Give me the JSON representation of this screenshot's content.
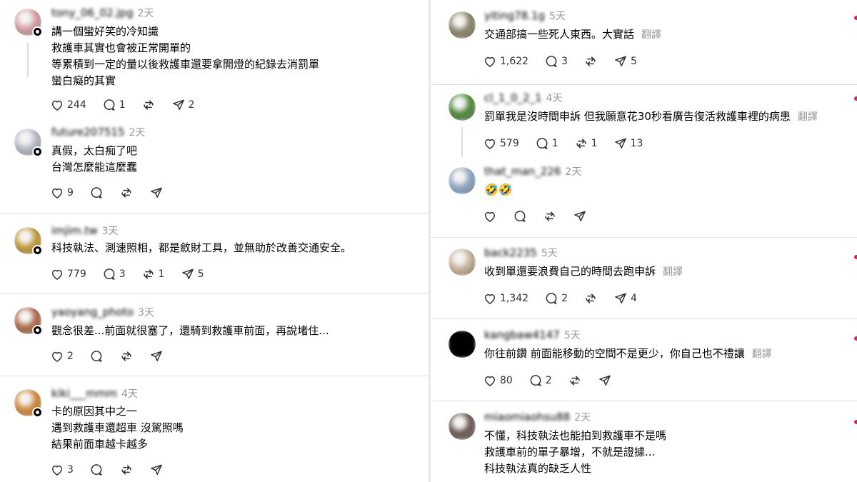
{
  "left": [
    {
      "username": "tony_06_02.jpg",
      "time": "2天",
      "lines": [
        "講一個蠻好笑的冷知識",
        "救護車其實也會被正常開單的",
        "等累積到一定的量以後救護車還要拿開燈的紀錄去消罰單",
        "蠻白癡的其實"
      ],
      "likes": "244",
      "replies": "1",
      "reposts": "",
      "shares": "2",
      "avatar_color": "#d9a0a8"
    },
    {
      "username": "future207515",
      "time": "2天",
      "lines": [
        "真假，太白痴了吧",
        "台灣怎麼能這麼蠢"
      ],
      "likes": "9",
      "replies": "",
      "reposts": "",
      "shares": "",
      "avatar_color": "#b8bcc6"
    },
    {
      "username": "imjim.tw",
      "time": "3天",
      "lines": [
        "科技執法、測速照相，都是斂財工具，並無助於改善交通安全。"
      ],
      "likes": "779",
      "replies": "3",
      "reposts": "1",
      "shares": "5",
      "avatar_color": "#c49a3a"
    },
    {
      "username": "yaoyang_photo",
      "time": "3天",
      "lines": [
        "觀念很差...前面就很塞了，還騎到救護車前面，再說堵住..."
      ],
      "likes": "2",
      "replies": "",
      "reposts": "",
      "shares": "",
      "avatar_color": "#b06a48"
    },
    {
      "username": "kiki___mmm",
      "time": "4天",
      "lines": [
        "卡的原因其中之一",
        "遇到救護車還超車 沒駕照嗎",
        "結果前面車越卡越多"
      ],
      "likes": "3",
      "replies": "",
      "reposts": "",
      "shares": "",
      "avatar_color": "#d48a3a"
    }
  ],
  "right": [
    {
      "username": "yiting78.1g",
      "time": "5天",
      "lines": [
        "交通部搞一些死人東西。大實話"
      ],
      "translate": "翻譯",
      "likes": "1,622",
      "replies": "3",
      "reposts": "",
      "shares": "5",
      "avatar_color": "#8a8466"
    },
    {
      "username": "cl_1_0_2_1",
      "time": "4天",
      "lines": [
        "罰單我是沒時間申訴 但我願意花30秒看廣告復活救護車裡的病患"
      ],
      "translate": "翻譯",
      "likes": "579",
      "replies": "1",
      "reposts": "1",
      "shares": "13",
      "avatar_color": "#4f8a3a"
    },
    {
      "username": "that_man_226",
      "time": "2天",
      "lines": [],
      "emoji": "🤣🤣",
      "likes": "",
      "replies": "",
      "reposts": "",
      "shares": "",
      "avatar_color": "#8fa8c6"
    },
    {
      "username": "back2235",
      "time": "5天",
      "lines": [
        "收到單還要浪費自己的時間去跑申訴"
      ],
      "translate": "翻譯",
      "likes": "1,342",
      "replies": "2",
      "reposts": "",
      "shares": "4",
      "avatar_color": "#c9b49a"
    },
    {
      "username": "kangbaw4147",
      "time": "5天",
      "lines": [
        "你往前鑽 前面能移動的空間不是更少，你自己也不禮讓"
      ],
      "translate": "翻譯",
      "likes": "80",
      "replies": "2",
      "reposts": "",
      "shares": "",
      "avatar_color": "#000000"
    },
    {
      "username": "miaomiaohsu88",
      "time": "2天",
      "lines": [
        "不懂，科技執法也能拍到救護車不是嗎",
        "救護車前的單子暴增，不就是證據...",
        "科技執法真的缺乏人性"
      ],
      "likes": "",
      "replies": "",
      "reposts": "",
      "shares": "",
      "avatar_color": "#6a5a52"
    }
  ],
  "colors": {
    "divider": "#e2e2e2",
    "muted": "#999999",
    "accent": "#e0245e"
  },
  "icons": [
    "heart-icon",
    "reply-icon",
    "repost-icon",
    "share-icon",
    "verified-badge-icon"
  ]
}
